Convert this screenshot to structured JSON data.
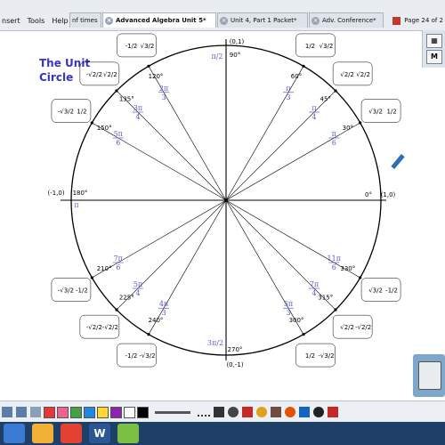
{
  "menu": {
    "items": [
      "nsert",
      "Tools",
      "Help"
    ]
  },
  "tabs": [
    {
      "label": "nf times",
      "active": false
    },
    {
      "label": "Advanced Algebra Unit 5*",
      "active": true
    },
    {
      "label": "Unit 4, Part 1 Packet*",
      "active": false
    },
    {
      "label": "Adv. Conference*",
      "active": false
    }
  ],
  "page_indicator": "Page 24 of 2",
  "right_panel": {
    "m_button": "M"
  },
  "diagram": {
    "title_line1": "The Unit",
    "title_line2": "Circle",
    "axis_points": [
      {
        "angle": 0,
        "coord": "(1,0)",
        "deg": "0°",
        "rad": ""
      },
      {
        "angle": 90,
        "coord": "(0,1)",
        "deg": "90°",
        "rad": "π/2"
      },
      {
        "angle": 180,
        "coord": "(-1,0)",
        "deg": "180°",
        "rad": "π"
      },
      {
        "angle": 270,
        "coord": "(0,-1)",
        "deg": "270°",
        "rad": "3π/2"
      }
    ],
    "angles": [
      {
        "angle": 30,
        "deg": "30°",
        "rad_num": "π",
        "rad_den": "6",
        "x": "√3/2",
        "y": "1/2"
      },
      {
        "angle": 45,
        "deg": "45°",
        "rad_num": "π",
        "rad_den": "4",
        "x": "√2/2",
        "y": "√2/2"
      },
      {
        "angle": 60,
        "deg": "60°",
        "rad_num": "π",
        "rad_den": "3",
        "x": "1/2",
        "y": "√3/2"
      },
      {
        "angle": 120,
        "deg": "120°",
        "rad_num": "2π",
        "rad_den": "3",
        "x": "-1/2",
        "y": "√3/2"
      },
      {
        "angle": 135,
        "deg": "135°",
        "rad_num": "3π",
        "rad_den": "4",
        "x": "-√2/2",
        "y": "√2/2"
      },
      {
        "angle": 150,
        "deg": "150°",
        "rad_num": "5π",
        "rad_den": "6",
        "x": "-√3/2",
        "y": "1/2"
      },
      {
        "angle": 210,
        "deg": "210°",
        "rad_num": "7π",
        "rad_den": "6",
        "x": "-√3/2",
        "y": "-1/2"
      },
      {
        "angle": 225,
        "deg": "225°",
        "rad_num": "5π",
        "rad_den": "4",
        "x": "-√2/2",
        "y": "-√2/2"
      },
      {
        "angle": 240,
        "deg": "240°",
        "rad_num": "4π",
        "rad_den": "3",
        "x": "-1/2",
        "y": "-√3/2"
      },
      {
        "angle": 300,
        "deg": "300°",
        "rad_num": "5π",
        "rad_den": "3",
        "x": "1/2",
        "y": "-√3/2"
      },
      {
        "angle": 315,
        "deg": "315°",
        "rad_num": "7π",
        "rad_den": "4",
        "x": "√2/2",
        "y": "-√2/2"
      },
      {
        "angle": 330,
        "deg": "330°",
        "rad_num": "11π",
        "rad_den": "6",
        "x": "√3/2",
        "y": "-1/2"
      }
    ]
  },
  "toolbar": {
    "colors": [
      "#e53935",
      "#f06292",
      "#43a047",
      "#1e88e5",
      "#fdd835",
      "#8e24aa",
      "#ffffff",
      "#000000"
    ],
    "icons": [
      "nav-back-icon",
      "nav-forward-icon",
      "grid-icon",
      "select-icon",
      "pen-icon",
      "highlighter-icon",
      "eraser-icon",
      "shape-icon",
      "fill-icon",
      "text-icon",
      "undo-icon",
      "redo-icon"
    ]
  },
  "taskbar": {
    "apps": [
      {
        "name": "start-icon",
        "color": "#3a7bd5"
      },
      {
        "name": "folder-icon",
        "color": "#f2b134"
      },
      {
        "name": "chrome-icon",
        "color": "#e34133"
      },
      {
        "name": "word-icon",
        "color": "#2b5797",
        "label": "W"
      },
      {
        "name": "smart-icon",
        "color": "#7bc043"
      }
    ]
  }
}
